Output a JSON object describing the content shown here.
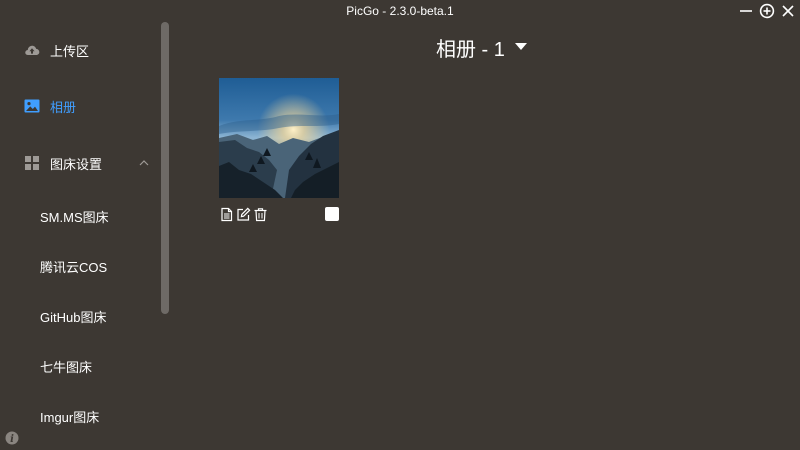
{
  "window": {
    "title": "PicGo - 2.3.0-beta.1"
  },
  "sidebar": {
    "items": [
      {
        "label": "上传区",
        "icon": "cloud-upload-icon"
      },
      {
        "label": "相册",
        "icon": "image-icon",
        "active": true
      },
      {
        "label": "图床设置",
        "icon": "grid-icon",
        "expanded": true
      },
      {
        "label": "SM.MS图床"
      },
      {
        "label": "腾讯云COS"
      },
      {
        "label": "GitHub图床"
      },
      {
        "label": "七牛图床"
      },
      {
        "label": "Imgur图床"
      }
    ]
  },
  "gallery": {
    "title": "相册 - 1",
    "items": [
      {
        "kind": "mountain-sunset-photo",
        "selected": false
      }
    ]
  },
  "colors": {
    "background": "#3d3833",
    "accent": "#409eff",
    "text": "#ffffff",
    "muted_icon": "#9e9a96"
  }
}
